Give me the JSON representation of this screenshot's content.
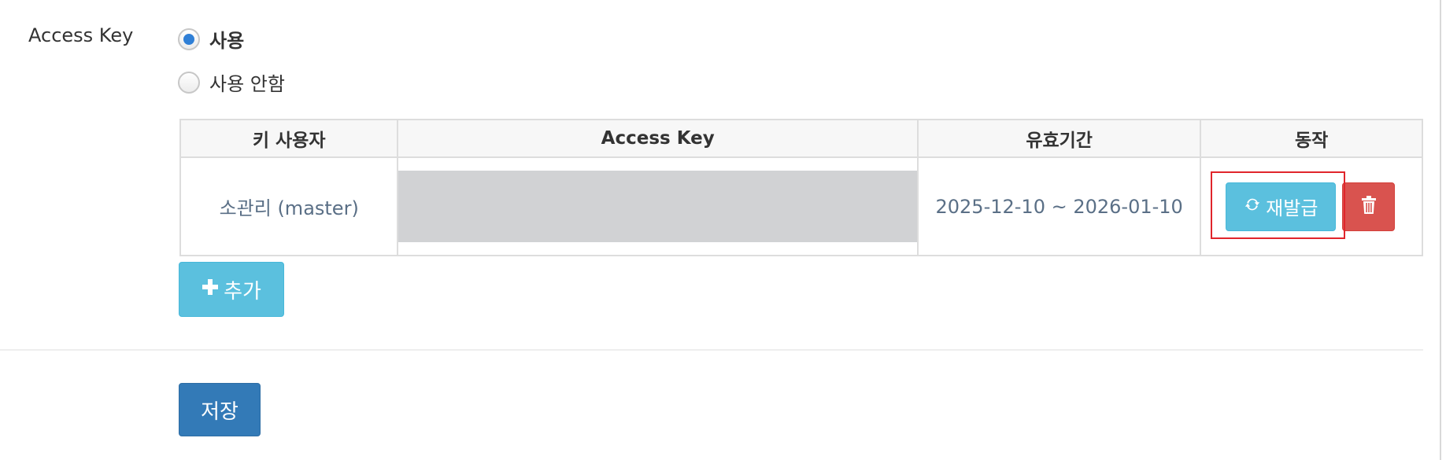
{
  "field": {
    "label": "Access Key"
  },
  "usage": {
    "options": [
      {
        "label": "사용",
        "checked": true
      },
      {
        "label": "사용 안함",
        "checked": false
      }
    ]
  },
  "table": {
    "headers": [
      "키 사용자",
      "Access Key",
      "유효기간",
      "동작"
    ],
    "rows": [
      {
        "user": "소관리 (master)",
        "access_key": "",
        "period": "2025-12-10 ~ 2026-01-10",
        "reissue_label": "재발급"
      }
    ]
  },
  "buttons": {
    "add_label": "추가",
    "save_label": "저장"
  },
  "icons": {
    "reissue": "refresh-icon",
    "delete": "trash-icon",
    "add": "plus-icon"
  },
  "colors": {
    "info": "#5bc0de",
    "danger": "#d9534f",
    "primary": "#337ab7",
    "highlight": "#e0252b",
    "masked": "#d1d2d4"
  }
}
